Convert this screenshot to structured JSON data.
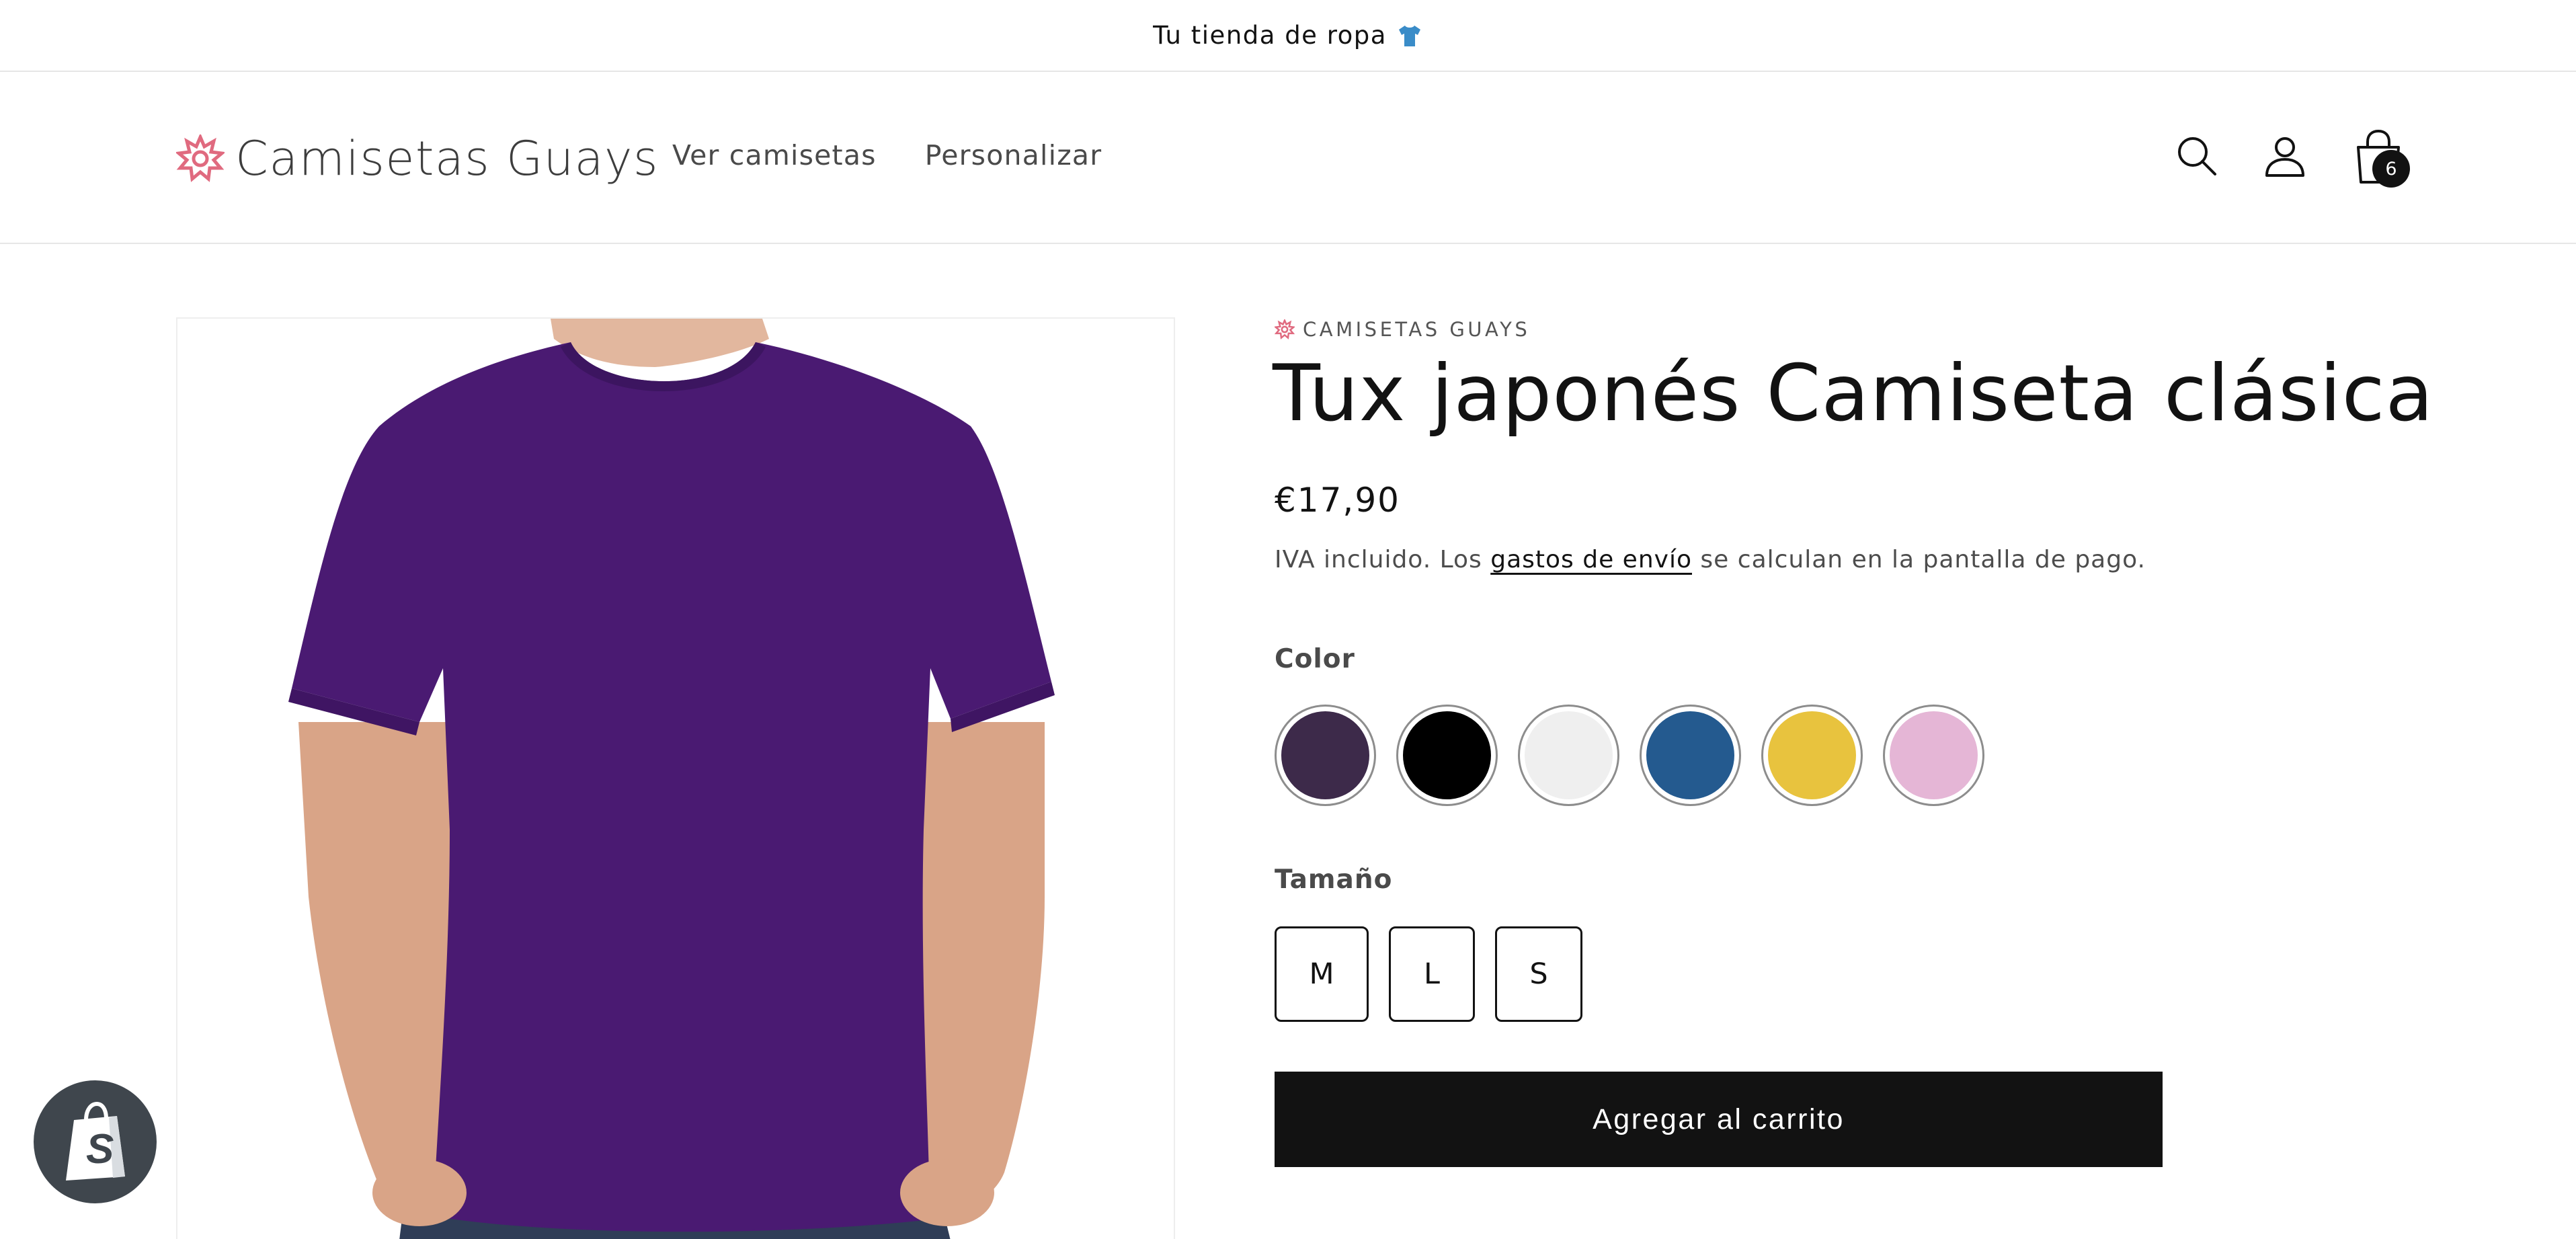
{
  "announcement": {
    "text": "Tu tienda de ropa",
    "icon": "tshirt-icon"
  },
  "header": {
    "store_name": "Camisetas Guays",
    "nav": [
      "Ver camisetas",
      "Personalizar"
    ],
    "icons": [
      "search-icon",
      "account-icon",
      "cart-icon"
    ],
    "cart_count": "6"
  },
  "product": {
    "vendor": "CAMISETAS GUAYS",
    "title": "Tux japonés Camiseta clásica",
    "price": "€17,90",
    "tax_note_prefix": "IVA incluido. Los ",
    "tax_note_link": "gastos de envío",
    "tax_note_suffix": " se calculan en la pantalla de pago.",
    "color_label": "Color",
    "colors": [
      "#3d2a4a",
      "#000000",
      "#efefef",
      "#245a8f",
      "#e8c33e",
      "#e5b6d6"
    ],
    "size_label": "Tamaño",
    "sizes": [
      "M",
      "L",
      "S"
    ],
    "add_to_cart": "Agregar al carrito",
    "shirt_color": "#4a1a72"
  },
  "badges": {
    "shop_icon": "shopify-bag-icon"
  }
}
